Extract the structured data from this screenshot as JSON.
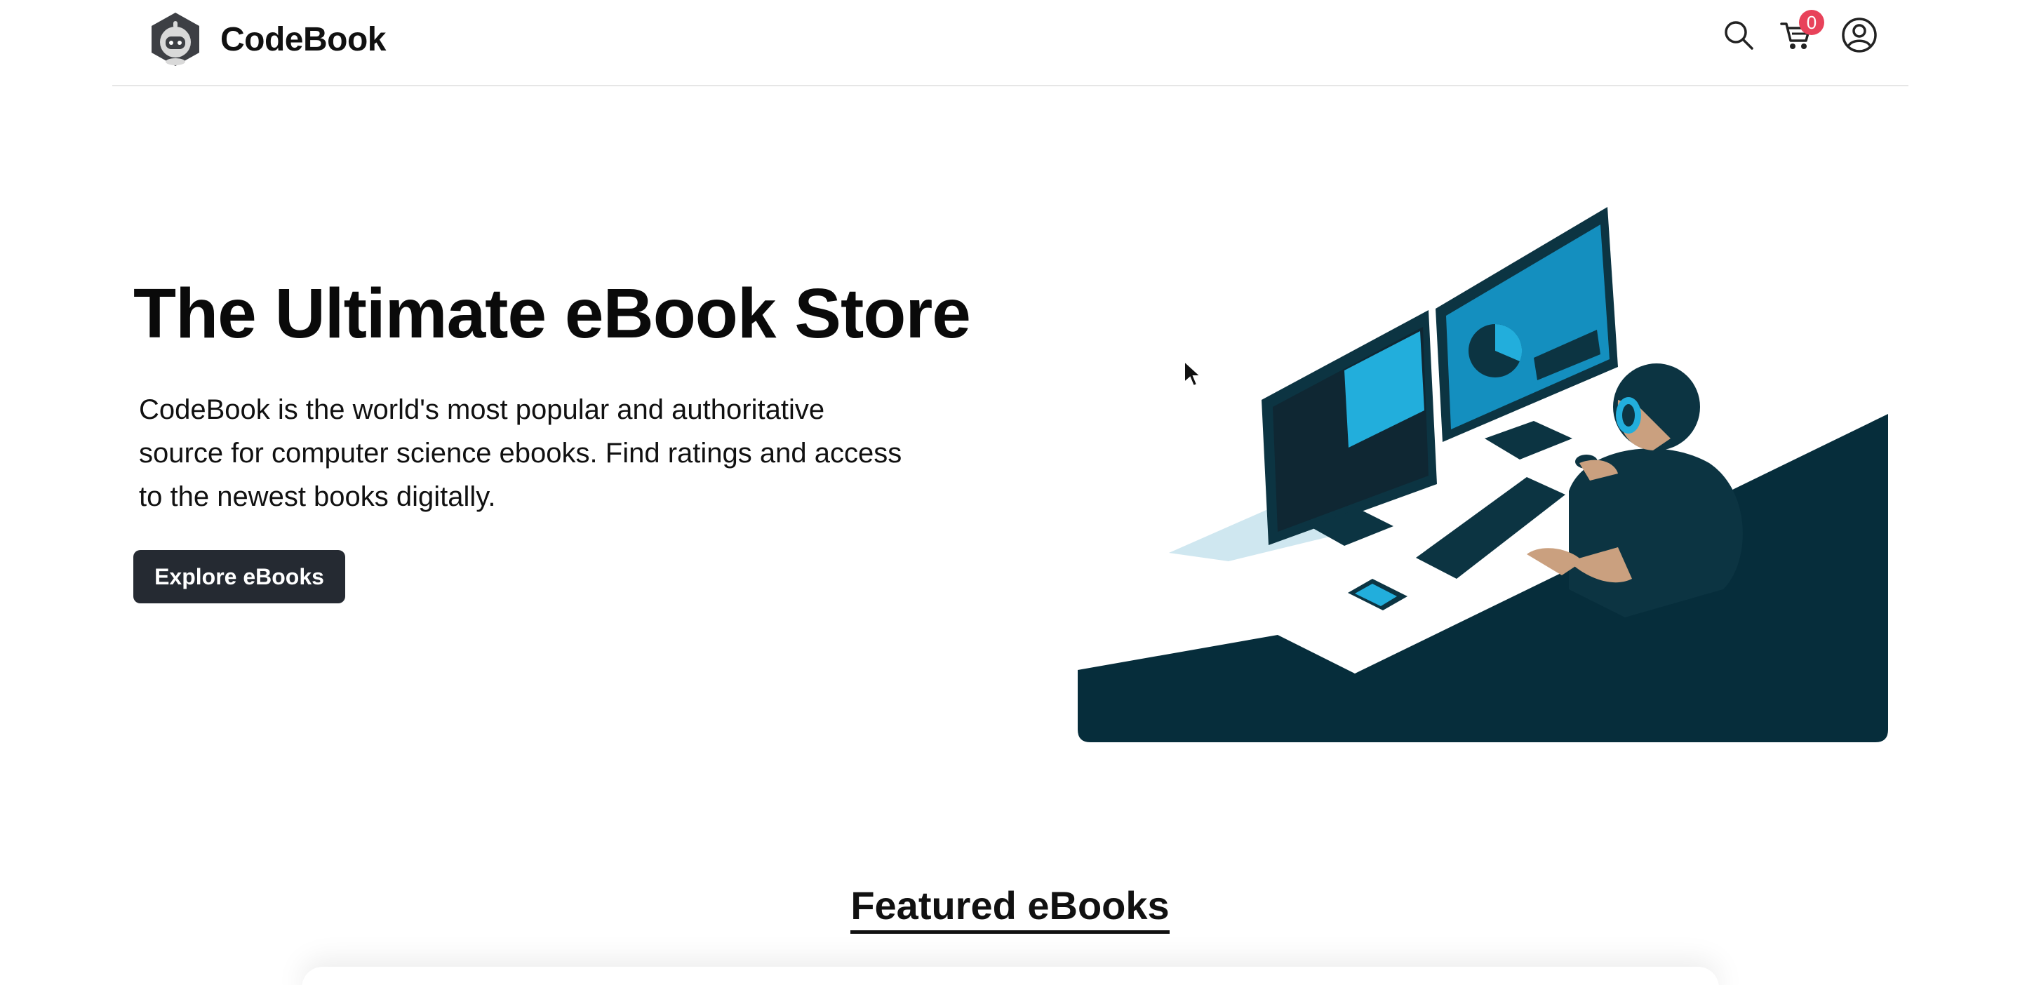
{
  "header": {
    "brand_name": "CodeBook",
    "logo_icon": "robot-hexagon-logo",
    "search_icon": "search-icon",
    "cart_icon": "cart-icon",
    "cart_count": "0",
    "user_icon": "user-circle-icon"
  },
  "hero": {
    "title": "The Ultimate eBook Store",
    "description": "CodeBook is the world's most popular and authoritative source for computer science ebooks. Find ratings and access to the newest books digitally.",
    "cta_label": "Explore eBooks",
    "illustration": "developer-at-dual-monitors-illustration"
  },
  "featured": {
    "title": "Featured eBooks"
  },
  "colors": {
    "button_bg": "#252a32",
    "badge_bg": "#e8425a",
    "illustration_dark": "#062d3b",
    "illustration_accent": "#0fa6d2"
  }
}
